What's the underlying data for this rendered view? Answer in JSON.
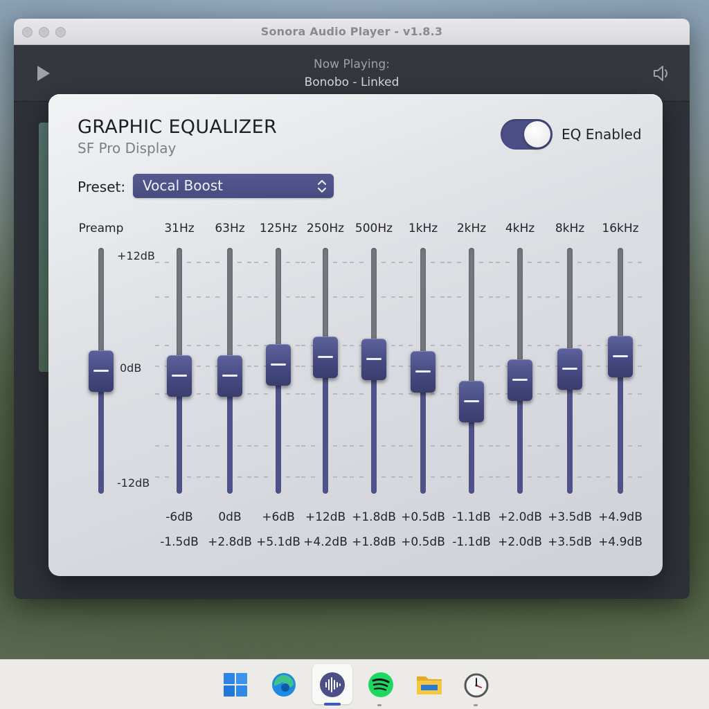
{
  "window": {
    "title": "Sonora Audio Player - v1.8.3"
  },
  "player": {
    "now_playing_label": "Now Playing:",
    "track": "Bonobo - Linked"
  },
  "eq": {
    "title": "GRAPHIC EQUALIZER",
    "subtitle": "SF Pro Display",
    "toggle_label": "EQ Enabled",
    "enabled": true,
    "preset_label": "Preset:",
    "preset_value": "Vocal Boost",
    "scale": {
      "max": "+12dB",
      "mid": "0dB",
      "min": "-12dB"
    },
    "accent_color": "#4b4f85",
    "preamp": {
      "label": "Preamp",
      "value_db": 0
    },
    "bands": [
      {
        "label": "31Hz",
        "row1": "-6dB",
        "row2": "-1.5dB",
        "value_db": -0.5
      },
      {
        "label": "63Hz",
        "row1": "0dB",
        "row2": "+2.8dB",
        "value_db": -0.5
      },
      {
        "label": "125Hz",
        "row1": "+6dB",
        "row2": "+5.1dB",
        "value_db": 0.6
      },
      {
        "label": "250Hz",
        "row1": "+12dB",
        "row2": "+4.2dB",
        "value_db": 1.3
      },
      {
        "label": "500Hz",
        "row1": "+1.8dB",
        "row2": "+1.8dB",
        "value_db": 1.1
      },
      {
        "label": "1kHz",
        "row1": "+0.5dB",
        "row2": "+0.5dB",
        "value_db": -0.1
      },
      {
        "label": "2kHz",
        "row1": "-1.1dB",
        "row2": "-1.1dB",
        "value_db": -3.0
      },
      {
        "label": "4kHz",
        "row1": "+2.0dB",
        "row2": "+2.0dB",
        "value_db": -0.9
      },
      {
        "label": "8kHz",
        "row1": "+3.5dB",
        "row2": "+3.5dB",
        "value_db": 0.2
      },
      {
        "label": "16kHz",
        "row1": "+4.9dB",
        "row2": "+4.9dB",
        "value_db": 1.4
      }
    ]
  },
  "taskbar": {
    "items": [
      {
        "name": "windows-start-icon"
      },
      {
        "name": "edge-browser-icon"
      },
      {
        "name": "audio-player-icon",
        "active": true
      },
      {
        "name": "spotify-icon"
      },
      {
        "name": "file-explorer-icon"
      },
      {
        "name": "clock-icon"
      }
    ]
  }
}
